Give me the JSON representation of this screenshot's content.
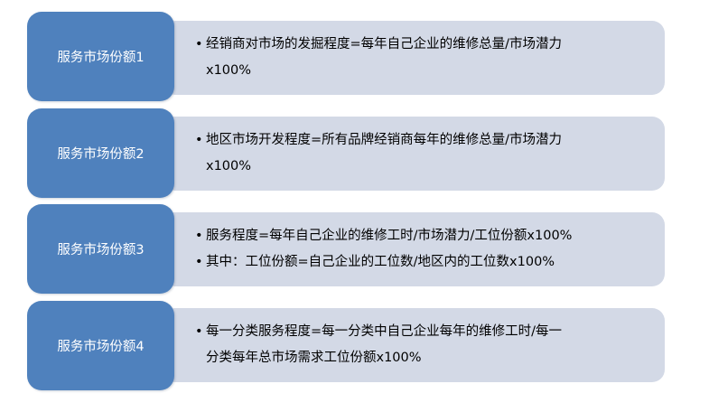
{
  "rows": [
    {
      "label": "服务市场份额1",
      "bullets": [
        {
          "lines": [
            "经销商对市场的发掘程度=每年自己企业的维修总量/市场潜力",
            "x100%"
          ]
        }
      ]
    },
    {
      "label": "服务市场份额2",
      "bullets": [
        {
          "lines": [
            "地区市场开发程度=所有品牌经销商每年的维修总量/市场潜力",
            "x100%"
          ]
        }
      ]
    },
    {
      "label": "服务市场份额3",
      "bullets": [
        {
          "lines": [
            "服务程度=每年自己企业的维修工时/市场潜力/工位份额x100%"
          ]
        },
        {
          "lines": [
            "其中：工位份额=自己企业的工位数/地区内的工位数x100%"
          ]
        }
      ]
    },
    {
      "label": "服务市场份额4",
      "bullets": [
        {
          "lines": [
            "每一分类服务程度=每一分类中自己企业每年的维修工时/每一",
            "分类每年总市场需求工位份额x100%"
          ]
        }
      ]
    }
  ],
  "bullet_char": "•",
  "colors": {
    "label_box": "#4f81bd",
    "detail_box": "#d3d9e6",
    "label_text": "#ffffff"
  }
}
